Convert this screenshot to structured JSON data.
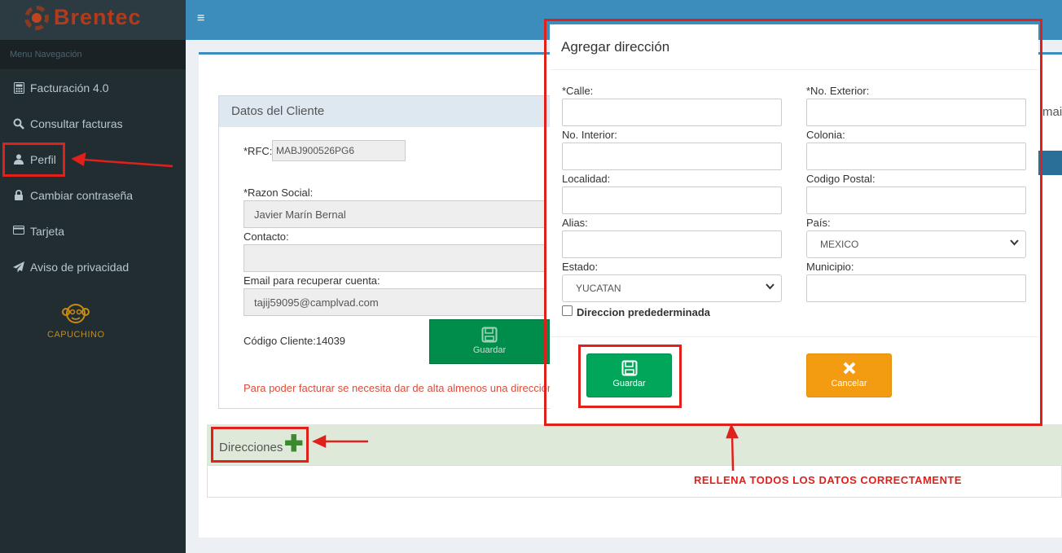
{
  "brand": {
    "name": "Brentec"
  },
  "sidebar": {
    "header": "Menu Navegación",
    "items": [
      {
        "label": "Facturación 4.0",
        "icon": "calculator-icon"
      },
      {
        "label": "Consultar facturas",
        "icon": "search-icon"
      },
      {
        "label": "Perfil",
        "icon": "user-icon"
      },
      {
        "label": "Cambiar contraseña",
        "icon": "lock-icon"
      },
      {
        "label": "Tarjeta",
        "icon": "credit-card-icon"
      },
      {
        "label": "Aviso de privacidad",
        "icon": "paper-plane-icon"
      }
    ],
    "partner": "CAPUCHINO"
  },
  "client": {
    "title": "Datos del Cliente",
    "rfc_label": "*RFC:",
    "rfc_value": "MABJ900526PG6",
    "razon_label": "*Razon Social:",
    "razon_value": "Javier Marín Bernal",
    "contacto_label": "Contacto:",
    "contacto_value": "",
    "email_label": "Email para recuperar cuenta:",
    "email_value": "tajij59095@camplvad.com",
    "codigo": "Código Cliente:14039",
    "save_label": "Guardar",
    "error": "Para poder facturar se necesita dar de alta almenos una dirección"
  },
  "right_partial": "mai",
  "direcciones": {
    "title": "Direcciones"
  },
  "modal": {
    "title": "Agregar dirección",
    "fields": {
      "calle": "*Calle:",
      "no_exterior": "*No. Exterior:",
      "no_interior": "No. Interior:",
      "colonia": "Colonia:",
      "localidad": "Localidad:",
      "codigo_postal": "Codigo Postal:",
      "alias": "Alias:",
      "pais": "País:",
      "estado": "Estado:",
      "municipio": "Municipio:"
    },
    "pais_value": "MEXICO",
    "estado_value": "YUCATAN",
    "checkbox_label": "Direccion predederminada",
    "save_label": "Guardar",
    "cancel_label": "Cancelar"
  },
  "annotation": "RELLENA TODOS LOS DATOS CORRECTAMENTE",
  "colors": {
    "accent": "#3c8dbc",
    "sidebar": "#222d32",
    "success": "#00a65a",
    "warning": "#f39c12",
    "annotation": "#e0201a"
  }
}
